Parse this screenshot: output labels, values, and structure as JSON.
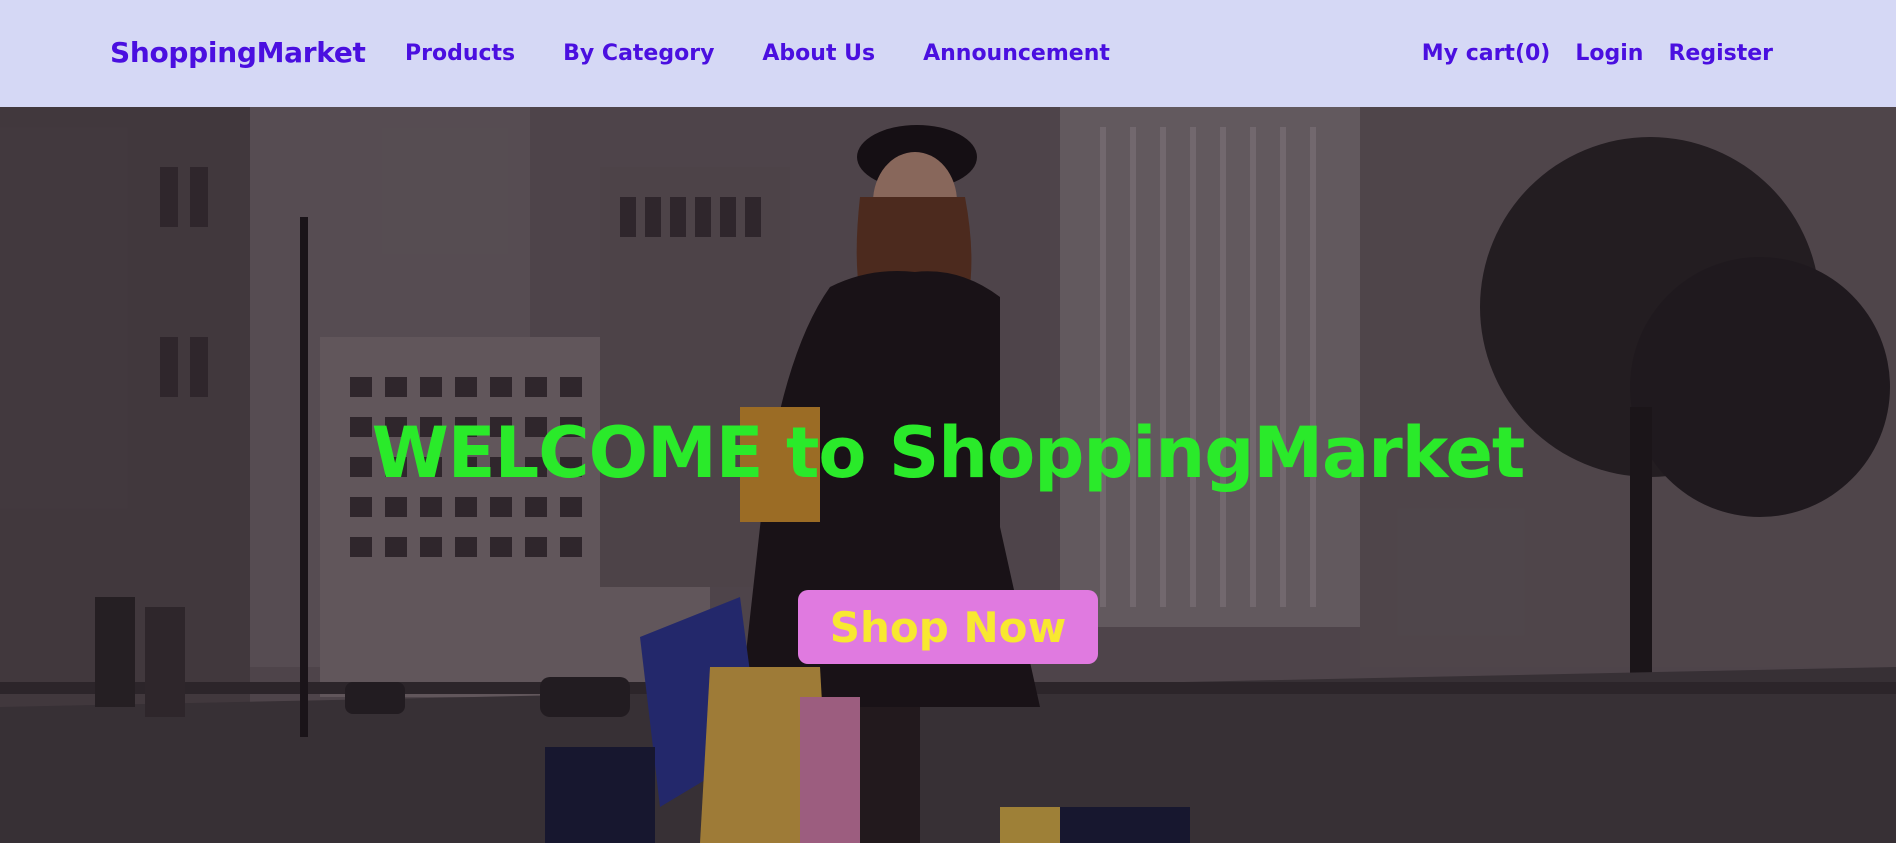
{
  "navbar": {
    "brand": "ShoppingMarket",
    "links": [
      {
        "label": "Products"
      },
      {
        "label": "By Category"
      },
      {
        "label": "About Us"
      },
      {
        "label": "Announcement"
      }
    ],
    "right": {
      "cart": "My cart(0)",
      "login": "Login",
      "register": "Register"
    }
  },
  "hero": {
    "title": "WELCOME to ShoppingMarket",
    "cta": "Shop Now"
  },
  "colors": {
    "navbar_bg": "#d5d8f5",
    "nav_text": "#4a0fe0",
    "hero_title": "#2aea2a",
    "cta_bg": "#e07ae0",
    "cta_text": "#f8e830"
  }
}
